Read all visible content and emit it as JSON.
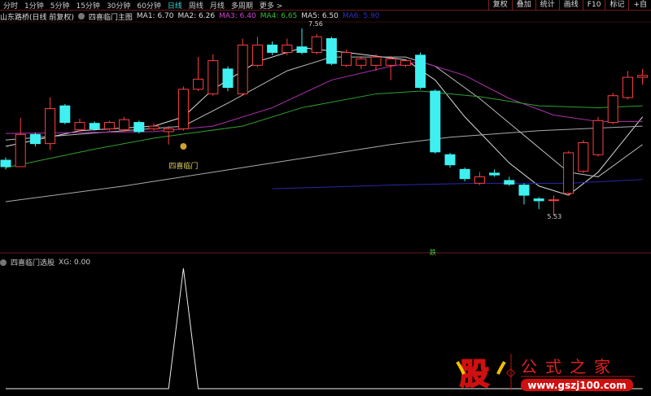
{
  "topbar": {
    "periods": [
      "分时",
      "1分钟",
      "5分钟",
      "15分钟",
      "30分钟",
      "60分钟",
      "日线",
      "周线",
      "月线",
      "多周期",
      "更多 >"
    ],
    "active": "日线",
    "right_buttons": [
      "复权",
      "叠加",
      "统计",
      "画线",
      "F10",
      "标记",
      "+自"
    ]
  },
  "info": {
    "stock": "山东路桥(日线 前复权)",
    "indicator": "四喜临门主图",
    "ma": [
      {
        "label": "MA1: 6.70",
        "color": "#dddddd"
      },
      {
        "label": "MA2: 6.26",
        "color": "#dddddd"
      },
      {
        "label": "MA3: 6.40",
        "color": "#d040d0"
      },
      {
        "label": "MA4: 6.65",
        "color": "#30c030"
      },
      {
        "label": "MA5: 6.50",
        "color": "#dddddd"
      },
      {
        "label": "MA6: 5.90",
        "color": "#3030c0"
      }
    ]
  },
  "annotations": {
    "high": "7.56",
    "low": "5.53",
    "signal": "四喜临门",
    "fall": "跌"
  },
  "indicator_panel": {
    "name": "四喜临门选股",
    "value": "XG: 0.00"
  },
  "logo": {
    "char": "股",
    "title": "公式之家",
    "url": "www.gszj100.com"
  },
  "colors": {
    "up": "#ff4040",
    "down": "#40f0f0",
    "ma_white": "#dddddd",
    "ma_magenta": "#b030b0",
    "ma_green": "#30a030",
    "ma_gray": "#aaaaaa",
    "ma_blue": "#2828b0"
  },
  "chart_data": {
    "type": "candlestick",
    "candles": [
      [
        6.13,
        6.06,
        6.16,
        6.03
      ],
      [
        6.06,
        6.41,
        6.59,
        6.06
      ],
      [
        6.41,
        6.31,
        6.43,
        6.28
      ],
      [
        6.31,
        6.69,
        6.81,
        6.24
      ],
      [
        6.72,
        6.54,
        6.74,
        6.52
      ],
      [
        6.46,
        6.54,
        6.58,
        6.44
      ],
      [
        6.53,
        6.47,
        6.55,
        6.45
      ],
      [
        6.47,
        6.54,
        6.56,
        6.45
      ],
      [
        6.46,
        6.57,
        6.6,
        6.44
      ],
      [
        6.54,
        6.44,
        6.56,
        6.42
      ],
      [
        6.47,
        6.5,
        6.53,
        6.45
      ],
      [
        6.44,
        6.47,
        6.5,
        6.3
      ],
      [
        6.47,
        6.9,
        6.93,
        6.45
      ],
      [
        6.9,
        7.01,
        7.25,
        6.88
      ],
      [
        6.85,
        7.21,
        7.28,
        6.83
      ],
      [
        7.12,
        6.92,
        7.15,
        6.88
      ],
      [
        6.85,
        7.38,
        7.45,
        6.83
      ],
      [
        7.16,
        7.38,
        7.47,
        7.14
      ],
      [
        7.38,
        7.3,
        7.42,
        7.27
      ],
      [
        7.3,
        7.38,
        7.45,
        7.27
      ],
      [
        7.36,
        7.3,
        7.56,
        7.28
      ],
      [
        7.3,
        7.47,
        7.5,
        7.28
      ],
      [
        7.45,
        7.18,
        7.47,
        7.16
      ],
      [
        7.16,
        7.3,
        7.33,
        7.14
      ],
      [
        7.16,
        7.23,
        7.26,
        7.12
      ],
      [
        7.16,
        7.25,
        7.28,
        7.1
      ],
      [
        7.16,
        7.23,
        7.26,
        7.0
      ],
      [
        7.16,
        7.21,
        7.23,
        7.14
      ],
      [
        7.27,
        6.92,
        7.3,
        6.9
      ],
      [
        6.88,
        6.22,
        6.9,
        6.2
      ],
      [
        6.19,
        6.08,
        6.21,
        6.05
      ],
      [
        6.03,
        5.93,
        6.05,
        5.9
      ],
      [
        5.88,
        5.95,
        6.0,
        5.86
      ],
      [
        5.99,
        5.97,
        6.03,
        5.95
      ],
      [
        5.91,
        5.87,
        5.95,
        5.85
      ],
      [
        5.86,
        5.75,
        5.88,
        5.65
      ],
      [
        5.71,
        5.69,
        5.73,
        5.6
      ],
      [
        5.7,
        5.7,
        5.75,
        5.53
      ],
      [
        5.77,
        6.21,
        6.23,
        5.75
      ],
      [
        6.01,
        6.32,
        6.35,
        5.99
      ],
      [
        6.19,
        6.56,
        6.6,
        6.17
      ],
      [
        6.54,
        6.83,
        6.86,
        6.52
      ],
      [
        6.81,
        7.03,
        7.1,
        6.79
      ],
      [
        7.03,
        7.05,
        7.12,
        6.95
      ]
    ],
    "ma_lines": [
      {
        "name": "MA1",
        "color": "#dddddd",
        "points": [
          [
            0,
            6.28
          ],
          [
            5,
            6.45
          ],
          [
            10,
            6.5
          ],
          [
            12,
            6.6
          ],
          [
            14,
            6.9
          ],
          [
            17,
            7.2
          ],
          [
            20,
            7.35
          ],
          [
            23,
            7.3
          ],
          [
            27,
            7.22
          ],
          [
            29,
            7.0
          ],
          [
            31,
            6.6
          ],
          [
            34,
            6.1
          ],
          [
            36,
            5.85
          ],
          [
            38,
            5.75
          ],
          [
            40,
            6.0
          ],
          [
            43,
            6.6
          ]
        ]
      },
      {
        "name": "MA2",
        "color": "#bbbbbb",
        "points": [
          [
            0,
            6.35
          ],
          [
            8,
            6.45
          ],
          [
            12,
            6.5
          ],
          [
            15,
            6.75
          ],
          [
            19,
            7.1
          ],
          [
            22,
            7.25
          ],
          [
            27,
            7.25
          ],
          [
            29,
            7.15
          ],
          [
            32,
            6.8
          ],
          [
            35,
            6.4
          ],
          [
            38,
            6.0
          ],
          [
            40,
            5.95
          ],
          [
            43,
            6.3
          ]
        ]
      },
      {
        "name": "MA3",
        "color": "#b030b0",
        "points": [
          [
            0,
            6.42
          ],
          [
            10,
            6.44
          ],
          [
            14,
            6.5
          ],
          [
            18,
            6.7
          ],
          [
            22,
            7.0
          ],
          [
            26,
            7.15
          ],
          [
            28,
            7.2
          ],
          [
            31,
            7.05
          ],
          [
            34,
            6.8
          ],
          [
            37,
            6.62
          ],
          [
            40,
            6.55
          ],
          [
            43,
            6.55
          ]
        ]
      },
      {
        "name": "MA4",
        "color": "#30a030",
        "points": [
          [
            0,
            6.05
          ],
          [
            6,
            6.25
          ],
          [
            10,
            6.37
          ],
          [
            16,
            6.5
          ],
          [
            20,
            6.7
          ],
          [
            25,
            6.85
          ],
          [
            28,
            6.88
          ],
          [
            32,
            6.82
          ],
          [
            36,
            6.72
          ],
          [
            40,
            6.7
          ],
          [
            43,
            6.72
          ]
        ]
      },
      {
        "name": "MA5",
        "color": "#aaaaaa",
        "points": [
          [
            0,
            5.68
          ],
          [
            8,
            5.85
          ],
          [
            14,
            6.0
          ],
          [
            20,
            6.15
          ],
          [
            26,
            6.3
          ],
          [
            30,
            6.38
          ],
          [
            36,
            6.45
          ],
          [
            43,
            6.5
          ]
        ]
      },
      {
        "name": "MA6",
        "color": "#2828b0",
        "points": [
          [
            18,
            5.82
          ],
          [
            26,
            5.86
          ],
          [
            32,
            5.88
          ],
          [
            38,
            5.88
          ],
          [
            43,
            5.92
          ]
        ]
      }
    ],
    "signal_index": 12,
    "xg": {
      "values_nonzero_index": 12,
      "max": 1
    }
  }
}
